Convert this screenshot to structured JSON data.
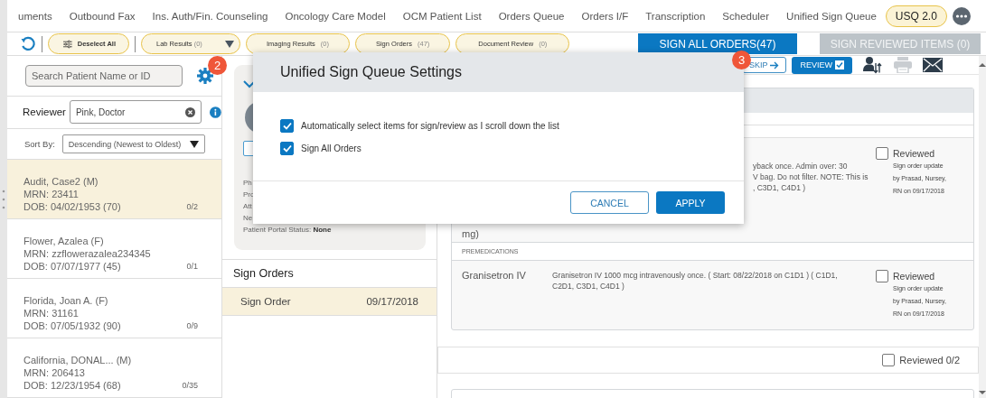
{
  "tabs": [
    {
      "label": "uments"
    },
    {
      "label": "Outbound Fax"
    },
    {
      "label": "Ins. Auth/Fin. Counseling"
    },
    {
      "label": "Oncology Care Model"
    },
    {
      "label": "OCM Patient List"
    },
    {
      "label": "Orders Queue"
    },
    {
      "label": "Orders I/F"
    },
    {
      "label": "Transcription"
    },
    {
      "label": "Scheduler"
    },
    {
      "label": "Unified Sign Queue"
    }
  ],
  "version_badge": "USQ 2.0",
  "toolbar": {
    "pills": [
      {
        "kind": "deselect",
        "label": "Deselect All"
      },
      {
        "kind": "dropdown",
        "label": "Lab Results",
        "count": "(0)"
      },
      {
        "kind": "plain",
        "label": "Imaging Results",
        "count": "(0)"
      },
      {
        "kind": "plain",
        "label": "Sign Orders",
        "count": "(47)"
      },
      {
        "kind": "plain",
        "label": "Document Review",
        "count": "(0)"
      }
    ],
    "sign_all": "SIGN ALL ORDERS(47)",
    "sign_reviewed": {
      "label": "SIGN REVIEWED ITEMS (0)",
      "disabled": true
    }
  },
  "step_badges": [
    "2",
    "3"
  ],
  "sidebar": {
    "search": {
      "placeholder": "Search Patient Name or ID"
    },
    "reviewer_label": "Reviewer",
    "reviewer_value": "Pink, Doctor",
    "sort_label": "Sort By:",
    "sort_value": "Descending (Newest to Oldest)",
    "patients": [
      {
        "name": "Audit, Case2 (M)",
        "mrn": "MRN: 23411",
        "dob": "DOB: 04/02/1953 (70)",
        "count": "0/2",
        "selected": true
      },
      {
        "name": "Flower, Azalea (F)",
        "mrn": "MRN: zzflowerazalea234345",
        "dob": "DOB: 07/07/1977 (45)",
        "count": "0/1",
        "selected": false
      },
      {
        "name": "Florida, Joan A. (F)",
        "mrn": "MRN: 31161",
        "dob": "DOB: 07/05/1932 (90)",
        "count": "0/9",
        "selected": false
      },
      {
        "name": "California, DONAL... (M)",
        "mrn": "MRN: 206413",
        "dob": "DOB: 12/23/1954 (68)",
        "count": "0/35",
        "selected": false
      }
    ]
  },
  "patient_card": {
    "lines": [
      "Ph",
      "Pro",
      "Att",
      "Ne"
    ],
    "portal_label": "Patient Portal Status:",
    "portal_value": "None"
  },
  "sign_orders": {
    "title": "Sign Orders",
    "rows": [
      {
        "label": "Sign Order",
        "date": "09/17/2018",
        "selected": true
      }
    ]
  },
  "order_toolbar": {
    "skip": "SKIP",
    "review": "REVIEW"
  },
  "orders": [
    {
      "kind": "order",
      "name_tail": "mg)",
      "desc": [
        "yback once. Admin over: 30",
        "V bag. Do not filter. NOTE: This is",
        ", C3D1, C4D1 )"
      ],
      "reviewed": false,
      "review_label": "Reviewed",
      "note": [
        "Sign order update",
        "by Prasad, Nursey,",
        "RN on 09/17/2018"
      ]
    },
    {
      "kind": "section",
      "name": "PREMEDICATIONS"
    },
    {
      "kind": "order",
      "name": "Granisetron IV",
      "desc": [
        "Granisetron IV 1000 mcg intravenously once. ( Start: 08/22/2018 on C1D1 ) ( C1D1,",
        "C2D1, C3D1, C4D1 )"
      ],
      "reviewed": false,
      "review_label": "Reviewed",
      "note": [
        "Sign order update",
        "by Prasad, Nursey,",
        "RN on 09/17/2018"
      ]
    }
  ],
  "reviewed_total": {
    "label": "Reviewed 0/2",
    "checked": false
  },
  "dialog": {
    "title": "Unified Sign Queue Settings",
    "options": [
      {
        "label": "Automatically select items for sign/review as I scroll down the list",
        "checked": true
      },
      {
        "label": "Sign All Orders",
        "checked": true
      }
    ],
    "cancel": "CANCEL",
    "apply": "APPLY"
  }
}
